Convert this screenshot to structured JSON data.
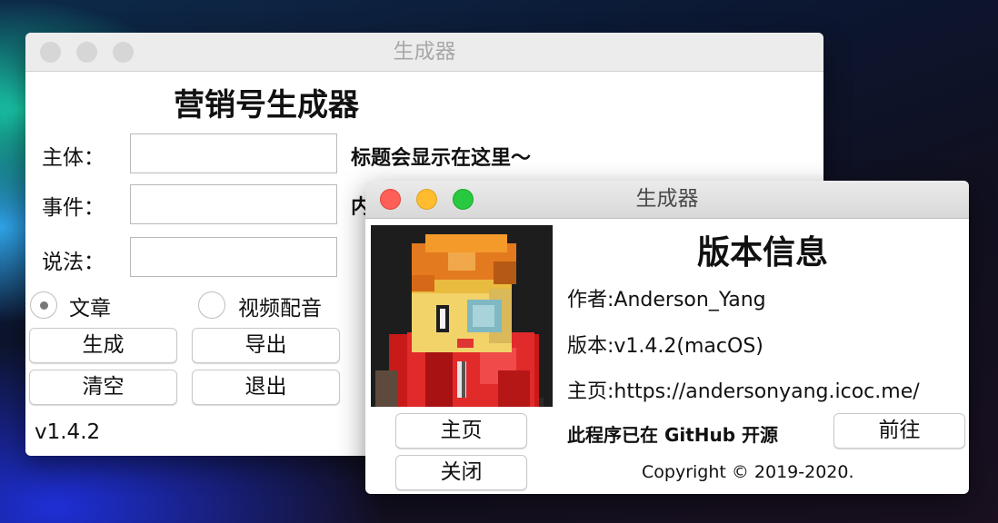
{
  "colors": {
    "close": "#fe5f57",
    "minimize": "#febc2e",
    "zoom": "#28c840",
    "inactive_dot": "#d6d6d6"
  },
  "main_window": {
    "title": "生成器",
    "heading": "营销号生成器",
    "fields": {
      "subject_label": "主体：",
      "event_label": "事件：",
      "statement_label": "说法：",
      "subject_value": "",
      "event_value": "",
      "statement_value": ""
    },
    "title_preview": "标题会显示在这里～",
    "content_preview": "内",
    "mode_options": [
      {
        "label": "文章",
        "selected": true
      },
      {
        "label": "视频配音",
        "selected": false
      }
    ],
    "buttons": {
      "generate": "生成",
      "export": "导出",
      "clear": "清空",
      "exit": "退出"
    },
    "version": "v1.4.2"
  },
  "about_window": {
    "title": "生成器",
    "heading": "版本信息",
    "avatar_icon": "minecraft-avatar-image",
    "author": "作者:Anderson_Yang",
    "version": "版本:v1.4.2(macOS)",
    "homepage": "主页:https://andersonyang.icoc.me/",
    "github_note": "此程序已在 GitHub 开源",
    "buttons": {
      "homepage": "主页",
      "goto": "前往",
      "close": "关闭"
    },
    "copyright": "Copyright © 2019-2020."
  }
}
